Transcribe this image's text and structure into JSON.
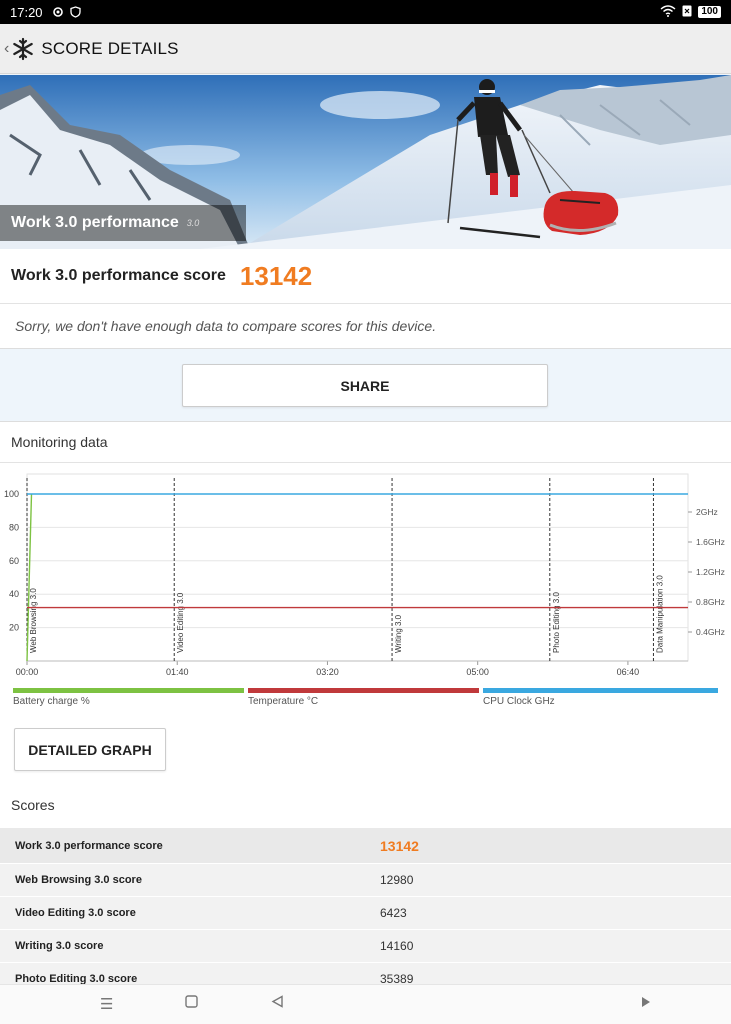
{
  "status": {
    "time": "17:20",
    "battery": "100",
    "icons": [
      "gear-icon",
      "shield-icon",
      "wifi-icon",
      "sim-icon"
    ]
  },
  "toolbar": {
    "title": "SCORE DETAILS",
    "icons": [
      "back-chevron-icon",
      "snowflake-logo-icon"
    ]
  },
  "hero": {
    "title": "Work 3.0 performance",
    "version": "3.0"
  },
  "score": {
    "label": "Work 3.0 performance score",
    "value": "13142",
    "note": "Sorry, we don't have enough data to compare scores for this device."
  },
  "share": {
    "label": "SHARE"
  },
  "monitoring": {
    "title": "Monitoring data",
    "detailed_label": "DETAILED GRAPH",
    "legend": [
      {
        "label": "Battery charge %",
        "color": "#7dc242"
      },
      {
        "label": "Temperature °C",
        "color": "#c0393b"
      },
      {
        "label": "CPU Clock GHz",
        "color": "#3aa8e0"
      }
    ]
  },
  "chart_data": {
    "type": "line",
    "x_ticks": [
      "00:00",
      "01:40",
      "03:20",
      "05:00",
      "06:40"
    ],
    "y_left_ticks": [
      "20",
      "40",
      "60",
      "80",
      "100"
    ],
    "y_left_range": [
      0,
      100
    ],
    "y_right_ticks": [
      "0.4GHz",
      "0.8GHz",
      "1.2GHz",
      "1.6GHz",
      "2GHz"
    ],
    "x_range_seconds": [
      0,
      440
    ],
    "markers": [
      {
        "label": "Web Browsing 3.0",
        "t": 0
      },
      {
        "label": "Video Editing 3.0",
        "t": 98
      },
      {
        "label": "Writing 3.0",
        "t": 243
      },
      {
        "label": "Photo Editing 3.0",
        "t": 348
      },
      {
        "label": "Data Manipulation 3.0",
        "t": 417
      }
    ],
    "series": [
      {
        "name": "Battery charge %",
        "color": "#7dc242",
        "points": [
          [
            0,
            0
          ],
          [
            3,
            100
          ]
        ]
      },
      {
        "name": "Temperature °C",
        "color": "#c0393b",
        "points": [
          [
            0,
            32
          ],
          [
            440,
            32
          ]
        ]
      },
      {
        "name": "CPU Clock GHz",
        "color": "#3aa8e0",
        "points": [
          [
            0,
            100
          ],
          [
            440,
            100
          ]
        ]
      }
    ]
  },
  "scores": {
    "title": "Scores",
    "rows": [
      {
        "name": "Work 3.0 performance score",
        "value": "13142"
      },
      {
        "name": "Web Browsing 3.0 score",
        "value": "12980"
      },
      {
        "name": "Video Editing 3.0 score",
        "value": "6423"
      },
      {
        "name": "Writing 3.0 score",
        "value": "14160"
      },
      {
        "name": "Photo Editing 3.0 score",
        "value": "35389"
      }
    ]
  },
  "nav": {
    "icons": [
      "menu-icon",
      "home-square-icon",
      "back-triangle-icon",
      "forward-triangle-icon"
    ]
  }
}
